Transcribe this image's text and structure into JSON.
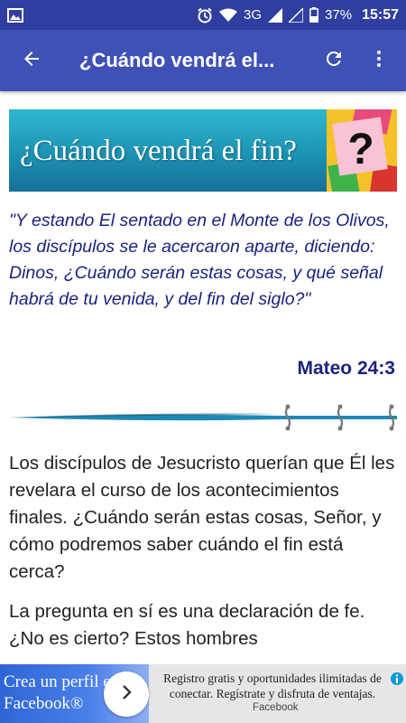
{
  "status_bar": {
    "network": "3G",
    "battery": "37%",
    "time": "15:57"
  },
  "app_bar": {
    "title": "¿Cuándo vendrá el..."
  },
  "banner": {
    "text": "¿Cuándo vendrá el fin?",
    "symbol": "?"
  },
  "quote": {
    "text": "\"Y estando El sentado en el Monte de los Olivos, los discípulos se le acercaron aparte, diciendo: Dinos, ¿Cuándo serán estas cosas, y qué señal habrá de tu venida, y del fin del siglo?\"",
    "reference": "Mateo 24:3"
  },
  "body": {
    "paragraphs": [
      "Los discípulos de Jesucristo querían que Él les revelara el curso de los acontecimientos finales. ¿Cuándo serán estas cosas, Señor, y cómo podremos saber cuándo el fin está cerca?",
      "La pregunta en sí es una declaración de fe. ¿No es cierto? Estos hombres"
    ]
  },
  "ad": {
    "headline": "Crea un perfil en Facebook®",
    "description": "Registro gratis y oportunidades ilimitadas de conectar. Regístrate y disfruta de ventajas.",
    "brand": "Facebook"
  },
  "colors": {
    "status_bar": "#303f9f",
    "app_bar": "#3f51b5",
    "quote_text": "#1a237e"
  }
}
